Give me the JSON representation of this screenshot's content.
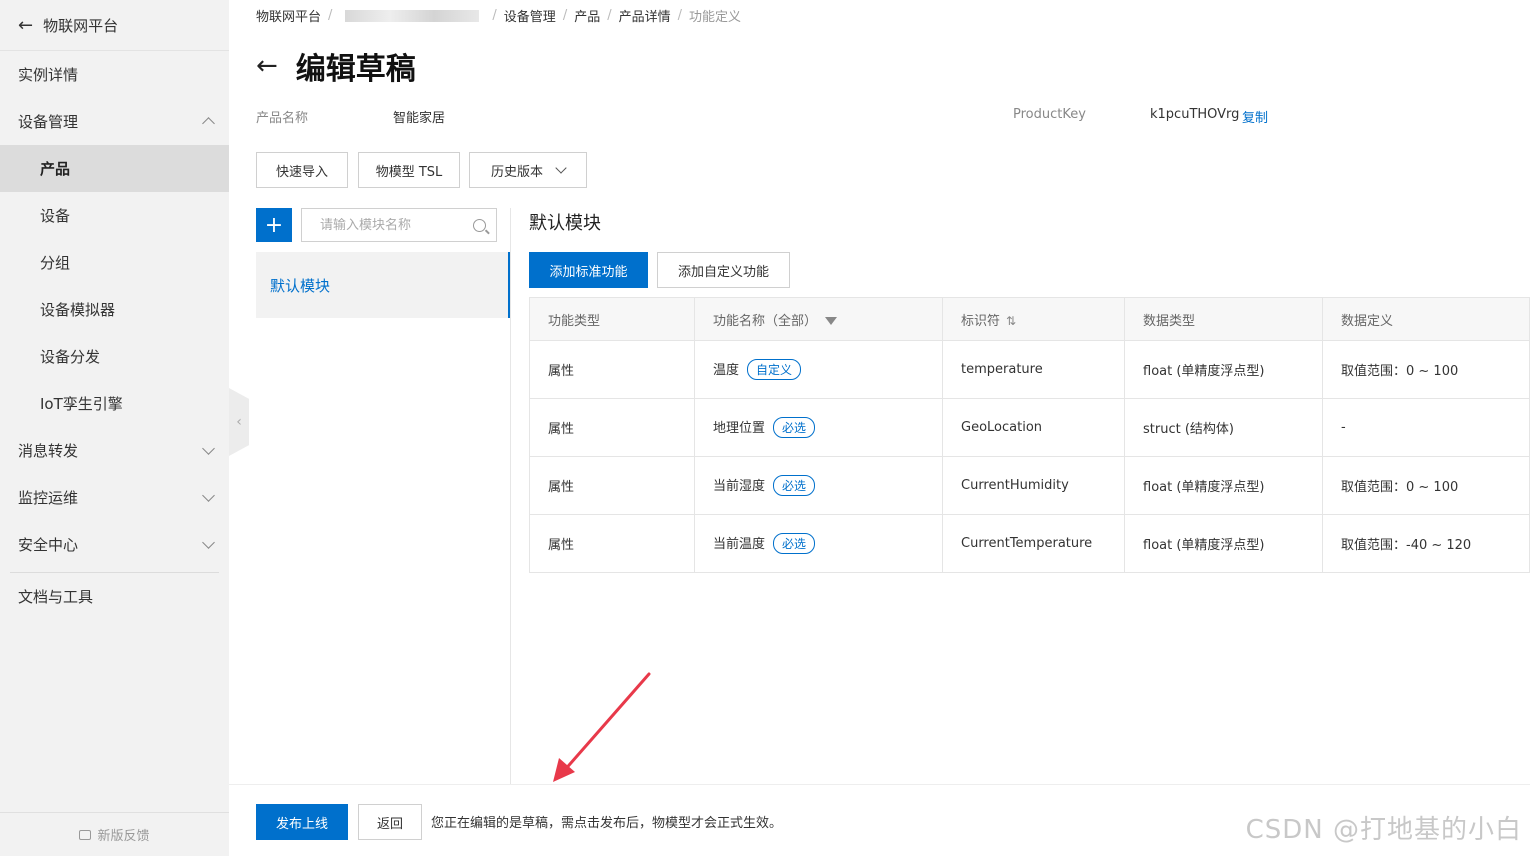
{
  "sidebar": {
    "title": "物联网平台",
    "items": [
      {
        "label": "实例详情"
      },
      {
        "label": "设备管理"
      },
      {
        "label": "消息转发"
      },
      {
        "label": "监控运维"
      },
      {
        "label": "安全中心"
      },
      {
        "label": "文档与工具"
      }
    ],
    "sub_items": [
      {
        "label": "产品"
      },
      {
        "label": "设备"
      },
      {
        "label": "分组"
      },
      {
        "label": "设备模拟器"
      },
      {
        "label": "设备分发"
      },
      {
        "label": "IoT孪生引擎"
      }
    ],
    "feedback": "新版反馈"
  },
  "breadcrumb": {
    "items": [
      "物联网平台",
      "设备管理",
      "产品",
      "产品详情",
      "功能定义"
    ]
  },
  "page": {
    "title": "编辑草稿",
    "product_name_label": "产品名称",
    "product_name_value": "智能家居",
    "product_key_label": "ProductKey",
    "product_key_value": "k1pcuTHOVrg",
    "copy_label": "复制"
  },
  "toolbar": {
    "quick_import": "快速导入",
    "tsl": "物模型 TSL",
    "history": "历史版本"
  },
  "module": {
    "search_placeholder": "请输入模块名称",
    "items": [
      "默认模块"
    ],
    "section_title": "默认模块",
    "add_standard": "添加标准功能",
    "add_custom": "添加自定义功能"
  },
  "table": {
    "headers": [
      "功能类型",
      "功能名称（全部）",
      "标识符",
      "数据类型",
      "数据定义"
    ],
    "rows": [
      {
        "type": "属性",
        "name": "温度",
        "tag": "自定义",
        "id": "temperature",
        "data_type": "float (单精度浮点型)",
        "def": "取值范围：0 ~ 100"
      },
      {
        "type": "属性",
        "name": "地理位置",
        "tag": "必选",
        "id": "GeoLocation",
        "data_type": "struct (结构体)",
        "def": "-"
      },
      {
        "type": "属性",
        "name": "当前湿度",
        "tag": "必选",
        "id": "CurrentHumidity",
        "data_type": "float (单精度浮点型)",
        "def": "取值范围：0 ~ 100"
      },
      {
        "type": "属性",
        "name": "当前温度",
        "tag": "必选",
        "id": "CurrentTemperature",
        "data_type": "float (单精度浮点型)",
        "def": "取值范围：-40 ~ 120"
      }
    ]
  },
  "footer": {
    "publish": "发布上线",
    "back": "返回",
    "note": "您正在编辑的是草稿，需点击发布后，物模型才会正式生效。"
  },
  "watermark": "CSDN @打地基的小白",
  "colors": {
    "accent": "#0070cc",
    "annotation": "#e8394a"
  }
}
